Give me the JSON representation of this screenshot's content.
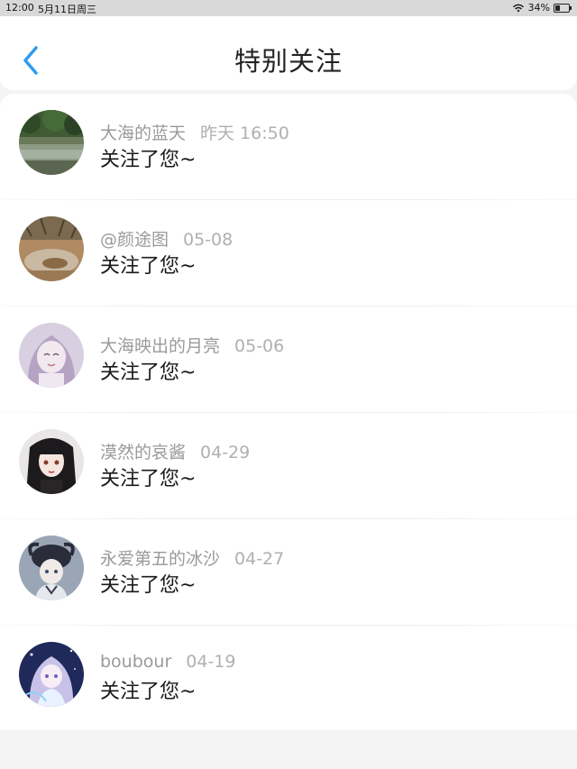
{
  "status_bar": {
    "time": "12:00",
    "date": "5月11日周三",
    "battery": "34%",
    "battery_level": 0.34
  },
  "nav": {
    "title": "特别关注",
    "back_icon": "chevron-left-icon",
    "accent_color": "#2f9bf0"
  },
  "items": [
    {
      "name": "大海的蓝天",
      "date": "昨天 16:50",
      "message": "关注了您~"
    },
    {
      "name": "@颜途图",
      "date": "05-08",
      "message": "关注了您~"
    },
    {
      "name": "大海映出的月亮",
      "date": "05-06",
      "message": "关注了您~"
    },
    {
      "name": "漠然的哀酱",
      "date": "04-29",
      "message": "关注了您~"
    },
    {
      "name": "永爱第五的冰沙",
      "date": "04-27",
      "message": "关注了您~"
    },
    {
      "name": "boubour",
      "date": "04-19",
      "message": "关注了您~"
    }
  ]
}
